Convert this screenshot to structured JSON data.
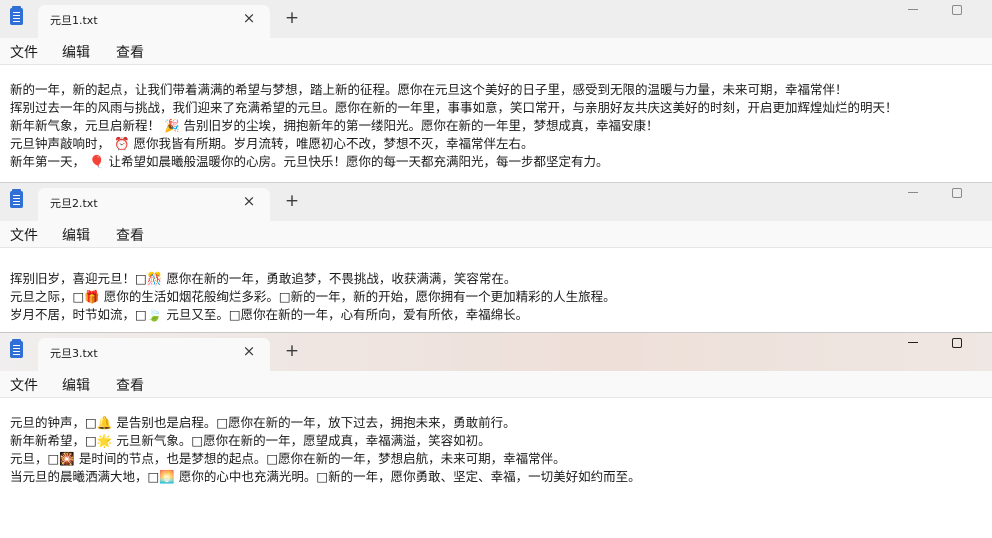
{
  "menu": {
    "file": "文件",
    "edit": "编辑",
    "view": "查看"
  },
  "tab_close_glyph": "×",
  "new_tab_glyph": "+",
  "windows": [
    {
      "tab_title": "元旦1.txt",
      "lines": [
        "新的一年，新的起点，让我们带着满满的希望与梦想，踏上新的征程。愿你在元旦这个美好的日子里，感受到无限的温暖与力量，未来可期，幸福常伴！",
        "挥别过去一年的风雨与挑战，我们迎来了充满希望的元旦。愿你在新的一年里，事事如意，笑口常开，与亲朋好友共庆这美好的时刻，开启更加辉煌灿烂的明天！",
        "新年新气象，元旦启新程！ 🎉 告别旧岁的尘埃，拥抱新年的第一缕阳光。愿你在新的一年里，梦想成真，幸福安康！",
        "元旦钟声敲响时， ⏰ 愿你我皆有所期。岁月流转，唯愿初心不改，梦想不灭，幸福常伴左右。",
        "新年第一天， 🎈 让希望如晨曦般温暖你的心房。元旦快乐！愿你的每一天都充满阳光，每一步都坚定有力。"
      ]
    },
    {
      "tab_title": "元旦2.txt",
      "lines": [
        "挥别旧岁，喜迎元旦！□🎊 愿你在新的一年，勇敢追梦，不畏挑战，收获满满，笑容常在。",
        "元旦之际，□🎁 愿你的生活如烟花般绚烂多彩。□新的一年，新的开始，愿你拥有一个更加精彩的人生旅程。",
        "岁月不居，时节如流，□🍃 元旦又至。□愿你在新的一年，心有所向，爱有所依，幸福绵长。"
      ]
    },
    {
      "tab_title": "元旦3.txt",
      "lines": [
        "元旦的钟声，□🔔 是告别也是启程。□愿你在新的一年，放下过去，拥抱未来，勇敢前行。",
        "新年新希望，□🌟 元旦新气象。□愿你在新的一年，愿望成真，幸福满溢，笑容如初。",
        "元旦，□🎇 是时间的节点，也是梦想的起点。□愿你在新的一年，梦想启航，未来可期，幸福常伴。",
        "当元旦的晨曦洒满大地，□🌅 愿你的心中也充满光明。□新的一年，愿你勇敢、坚定、幸福，一切美好如约而至。"
      ]
    }
  ]
}
